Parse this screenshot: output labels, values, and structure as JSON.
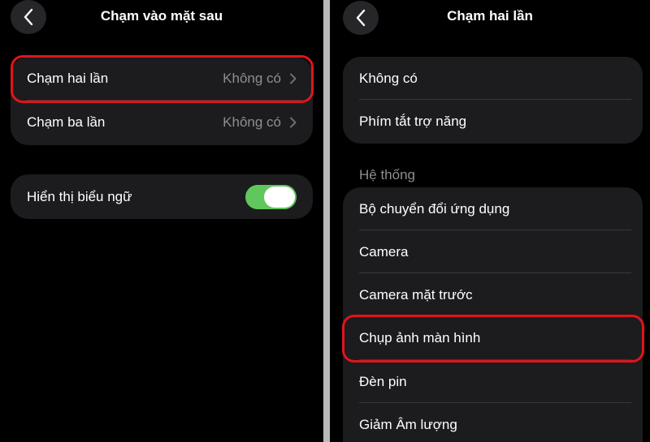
{
  "left": {
    "title": "Chạm vào mặt sau",
    "tap_group": [
      {
        "label": "Chạm hai lần",
        "value": "Không có"
      },
      {
        "label": "Chạm ba lần",
        "value": "Không có"
      }
    ],
    "banner": {
      "label": "Hiển thị biểu ngữ",
      "enabled": true
    }
  },
  "right": {
    "title": "Chạm hai lần",
    "top_group": [
      "Không có",
      "Phím tắt trợ năng"
    ],
    "section_header": "Hệ thống",
    "system_group": [
      "Bộ chuyển đổi ứng dụng",
      "Camera",
      "Camera mặt trước",
      "Chụp ảnh màn hình",
      "Đèn pin",
      "Giảm Âm lượng"
    ]
  },
  "colors": {
    "highlight": "#e0141d",
    "toggle_on": "#5fc75b",
    "cell_bg": "#1c1c1e",
    "secondary_text": "#8d8d93"
  }
}
